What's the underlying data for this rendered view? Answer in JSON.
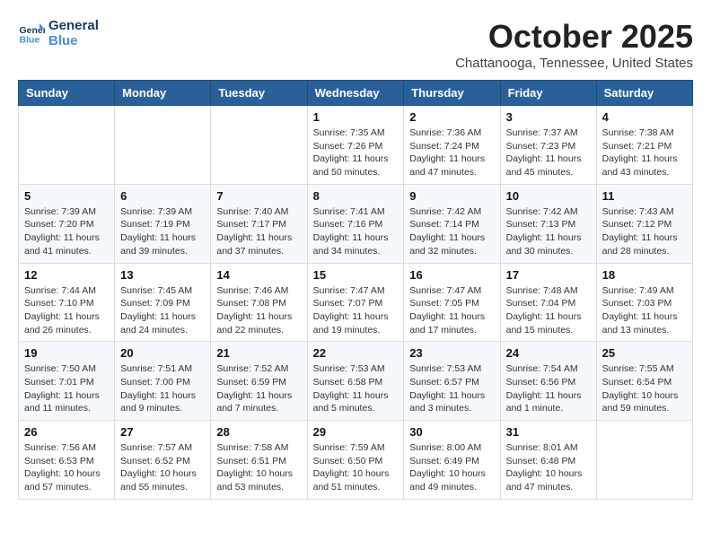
{
  "header": {
    "logo_line1": "General",
    "logo_line2": "Blue",
    "month": "October 2025",
    "location": "Chattanooga, Tennessee, United States"
  },
  "weekdays": [
    "Sunday",
    "Monday",
    "Tuesday",
    "Wednesday",
    "Thursday",
    "Friday",
    "Saturday"
  ],
  "weeks": [
    [
      {
        "day": "",
        "info": ""
      },
      {
        "day": "",
        "info": ""
      },
      {
        "day": "",
        "info": ""
      },
      {
        "day": "1",
        "info": "Sunrise: 7:35 AM\nSunset: 7:26 PM\nDaylight: 11 hours\nand 50 minutes."
      },
      {
        "day": "2",
        "info": "Sunrise: 7:36 AM\nSunset: 7:24 PM\nDaylight: 11 hours\nand 47 minutes."
      },
      {
        "day": "3",
        "info": "Sunrise: 7:37 AM\nSunset: 7:23 PM\nDaylight: 11 hours\nand 45 minutes."
      },
      {
        "day": "4",
        "info": "Sunrise: 7:38 AM\nSunset: 7:21 PM\nDaylight: 11 hours\nand 43 minutes."
      }
    ],
    [
      {
        "day": "5",
        "info": "Sunrise: 7:39 AM\nSunset: 7:20 PM\nDaylight: 11 hours\nand 41 minutes."
      },
      {
        "day": "6",
        "info": "Sunrise: 7:39 AM\nSunset: 7:19 PM\nDaylight: 11 hours\nand 39 minutes."
      },
      {
        "day": "7",
        "info": "Sunrise: 7:40 AM\nSunset: 7:17 PM\nDaylight: 11 hours\nand 37 minutes."
      },
      {
        "day": "8",
        "info": "Sunrise: 7:41 AM\nSunset: 7:16 PM\nDaylight: 11 hours\nand 34 minutes."
      },
      {
        "day": "9",
        "info": "Sunrise: 7:42 AM\nSunset: 7:14 PM\nDaylight: 11 hours\nand 32 minutes."
      },
      {
        "day": "10",
        "info": "Sunrise: 7:42 AM\nSunset: 7:13 PM\nDaylight: 11 hours\nand 30 minutes."
      },
      {
        "day": "11",
        "info": "Sunrise: 7:43 AM\nSunset: 7:12 PM\nDaylight: 11 hours\nand 28 minutes."
      }
    ],
    [
      {
        "day": "12",
        "info": "Sunrise: 7:44 AM\nSunset: 7:10 PM\nDaylight: 11 hours\nand 26 minutes."
      },
      {
        "day": "13",
        "info": "Sunrise: 7:45 AM\nSunset: 7:09 PM\nDaylight: 11 hours\nand 24 minutes."
      },
      {
        "day": "14",
        "info": "Sunrise: 7:46 AM\nSunset: 7:08 PM\nDaylight: 11 hours\nand 22 minutes."
      },
      {
        "day": "15",
        "info": "Sunrise: 7:47 AM\nSunset: 7:07 PM\nDaylight: 11 hours\nand 19 minutes."
      },
      {
        "day": "16",
        "info": "Sunrise: 7:47 AM\nSunset: 7:05 PM\nDaylight: 11 hours\nand 17 minutes."
      },
      {
        "day": "17",
        "info": "Sunrise: 7:48 AM\nSunset: 7:04 PM\nDaylight: 11 hours\nand 15 minutes."
      },
      {
        "day": "18",
        "info": "Sunrise: 7:49 AM\nSunset: 7:03 PM\nDaylight: 11 hours\nand 13 minutes."
      }
    ],
    [
      {
        "day": "19",
        "info": "Sunrise: 7:50 AM\nSunset: 7:01 PM\nDaylight: 11 hours\nand 11 minutes."
      },
      {
        "day": "20",
        "info": "Sunrise: 7:51 AM\nSunset: 7:00 PM\nDaylight: 11 hours\nand 9 minutes."
      },
      {
        "day": "21",
        "info": "Sunrise: 7:52 AM\nSunset: 6:59 PM\nDaylight: 11 hours\nand 7 minutes."
      },
      {
        "day": "22",
        "info": "Sunrise: 7:53 AM\nSunset: 6:58 PM\nDaylight: 11 hours\nand 5 minutes."
      },
      {
        "day": "23",
        "info": "Sunrise: 7:53 AM\nSunset: 6:57 PM\nDaylight: 11 hours\nand 3 minutes."
      },
      {
        "day": "24",
        "info": "Sunrise: 7:54 AM\nSunset: 6:56 PM\nDaylight: 11 hours\nand 1 minute."
      },
      {
        "day": "25",
        "info": "Sunrise: 7:55 AM\nSunset: 6:54 PM\nDaylight: 10 hours\nand 59 minutes."
      }
    ],
    [
      {
        "day": "26",
        "info": "Sunrise: 7:56 AM\nSunset: 6:53 PM\nDaylight: 10 hours\nand 57 minutes."
      },
      {
        "day": "27",
        "info": "Sunrise: 7:57 AM\nSunset: 6:52 PM\nDaylight: 10 hours\nand 55 minutes."
      },
      {
        "day": "28",
        "info": "Sunrise: 7:58 AM\nSunset: 6:51 PM\nDaylight: 10 hours\nand 53 minutes."
      },
      {
        "day": "29",
        "info": "Sunrise: 7:59 AM\nSunset: 6:50 PM\nDaylight: 10 hours\nand 51 minutes."
      },
      {
        "day": "30",
        "info": "Sunrise: 8:00 AM\nSunset: 6:49 PM\nDaylight: 10 hours\nand 49 minutes."
      },
      {
        "day": "31",
        "info": "Sunrise: 8:01 AM\nSunset: 6:48 PM\nDaylight: 10 hours\nand 47 minutes."
      },
      {
        "day": "",
        "info": ""
      }
    ]
  ]
}
